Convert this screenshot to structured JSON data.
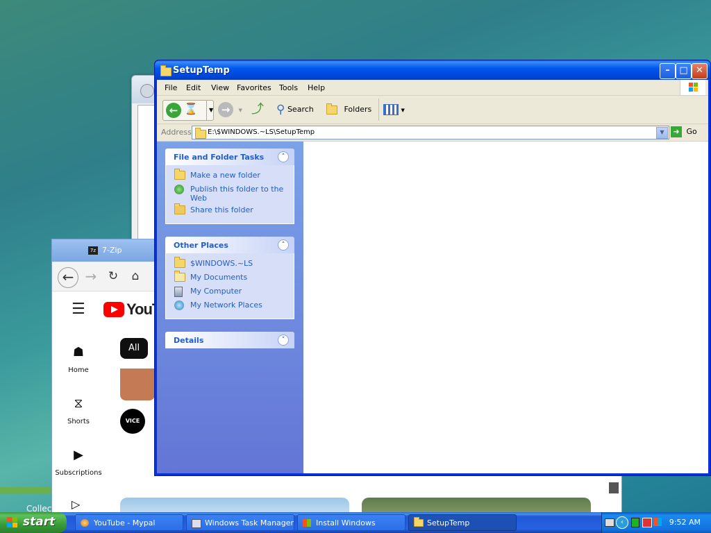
{
  "explorer": {
    "title": "SetupTemp",
    "menu": [
      "File",
      "Edit",
      "View",
      "Favorites",
      "Tools",
      "Help"
    ],
    "toolbar": {
      "back_label": "Back",
      "search_label": "Search",
      "folders_label": "Folders"
    },
    "address": {
      "label": "Address",
      "value": "E:\\$WINDOWS.~LS\\SetupTemp",
      "go_label": "Go"
    },
    "tasks": {
      "title": "File and Folder Tasks",
      "items": [
        "Make a new folder",
        "Publish this folder to the Web",
        "Share this folder"
      ]
    },
    "places": {
      "title": "Other Places",
      "items": [
        "$WINDOWS.~LS",
        "My Documents",
        "My Computer",
        "My Network Places"
      ]
    },
    "details": {
      "title": "Details"
    }
  },
  "browser": {
    "tab_title": "7-Zip",
    "logo_text": "YouTu",
    "sidebar": [
      "Home",
      "Shorts",
      "Subscriptions"
    ],
    "chip": "All",
    "channel_badge": "VICE"
  },
  "desktop": {
    "collect_label": "Collect"
  },
  "taskbar": {
    "start_label": "start",
    "tasks": [
      {
        "label": "YouTube - Mypal",
        "active": false
      },
      {
        "label": "Windows Task Manager",
        "active": false
      },
      {
        "label": "Install Windows",
        "active": false
      },
      {
        "label": "SetupTemp",
        "active": true
      }
    ],
    "clock": "9:52 AM"
  },
  "colors": {
    "xp_blue": "#0831d9",
    "link_blue": "#215dc6",
    "start_green": "#389b38",
    "taskbar_blue": "#2663e0"
  }
}
